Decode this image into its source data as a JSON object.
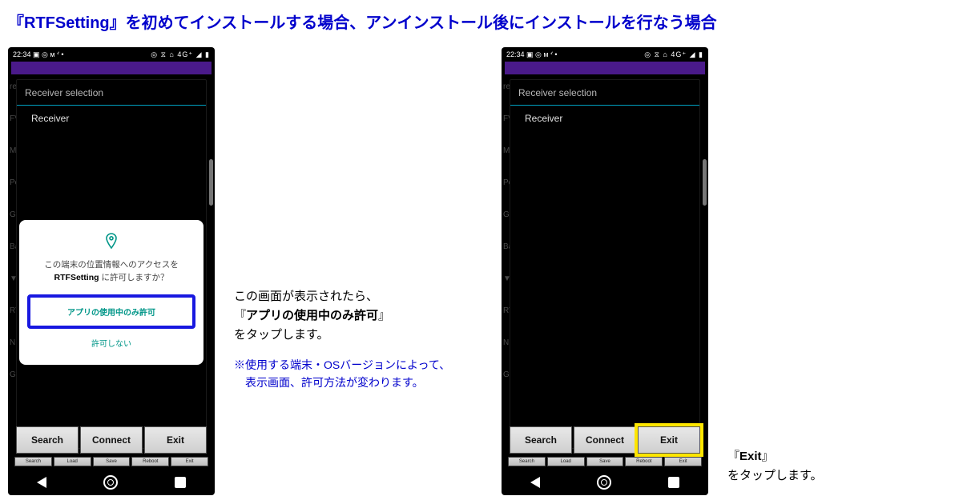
{
  "title": "『RTFSetting』を初めてインストールする場合、アンインストール後にインストールを行なう場合",
  "statusbar": {
    "time": "22:34",
    "icons_left": "▣ ◎ ᴍ ᔊ •",
    "icons_right": "◎ ⧖ ⌂ 4G⁺ ◢ ▮"
  },
  "modal": {
    "title": "Receiver selection",
    "item": "Receiver"
  },
  "bg_side_labels": [
    "re",
    "FV",
    "M",
    "Pc",
    "GI",
    "Ba",
    "▼",
    "RT",
    "NI",
    "GI"
  ],
  "buttons": {
    "search": "Search",
    "connect": "Connect",
    "exit": "Exit"
  },
  "bg_buttons": [
    "Search",
    "Load",
    "Save",
    "Reboot",
    "Exit"
  ],
  "perm": {
    "line1": "この端末の位置情報へのアクセスを",
    "app": "RTFSetting",
    "line2": " に許可しますか？",
    "allow": "アプリの使用中のみ許可",
    "deny": "許可しない"
  },
  "ann1": {
    "l1": "この画面が表示されたら、",
    "l2a": "『",
    "l2b": "アプリの使用中のみ許可",
    "l2c": "』",
    "l3": "をタップします。",
    "note1": "※使用する端末・OSバージョンによって、",
    "note2": "　表示画面、許可方法が変わります。"
  },
  "ann2": {
    "l1a": "『",
    "l1b": "Exit",
    "l1c": "』",
    "l2": "をタップします。"
  }
}
